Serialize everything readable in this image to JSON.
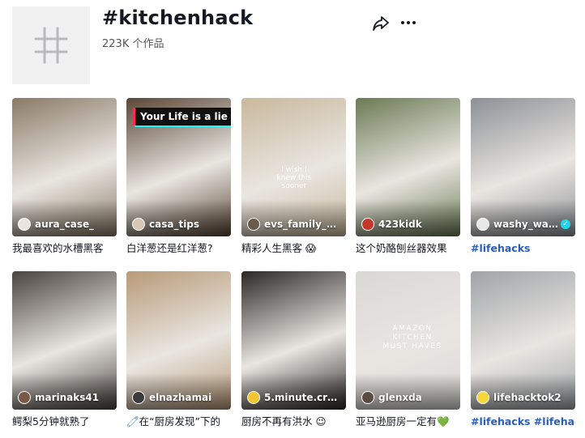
{
  "header": {
    "title": "#kitchenhack",
    "count": "223K 个作品"
  },
  "videos": [
    {
      "user": "aura_case_",
      "caption": "我最喜欢的水槽黑客",
      "tag": false,
      "verified": false,
      "overlay": ""
    },
    {
      "user": "casa_tips",
      "caption": "白洋葱还是红洋葱?",
      "tag": false,
      "verified": false,
      "overlay": "Your Life is a lie"
    },
    {
      "user": "evs_family_h...",
      "caption": "精彩人生黑客 😱",
      "tag": false,
      "verified": false,
      "overlay": "I wish I knew this sooner"
    },
    {
      "user": "423kidk",
      "caption": "这个奶酪刨丝器效果",
      "tag": false,
      "verified": false,
      "overlay": ""
    },
    {
      "user": "washy_wa...",
      "caption": "#lifehacks",
      "tag": true,
      "verified": true,
      "overlay": ""
    },
    {
      "user": "marinaks41",
      "caption": "鳄梨5分钟就熟了",
      "tag": false,
      "verified": false,
      "overlay": ""
    },
    {
      "user": "elnazhamai",
      "caption": "🧷在“厨房发现”下的",
      "tag": false,
      "verified": false,
      "overlay": ""
    },
    {
      "user": "5.minute.cra...",
      "caption": "厨房不再有洪水 😉",
      "tag": false,
      "verified": false,
      "overlay": ""
    },
    {
      "user": "glenxda",
      "caption": "亚马逊厨房一定有💚",
      "tag": false,
      "verified": false,
      "overlay": "AMAZON KITCHEN MUST HAVES"
    },
    {
      "user": "lifehacktok2",
      "caption": "#lifehacks #lifehack",
      "tag": true,
      "verified": false,
      "overlay": ""
    }
  ],
  "colors": {
    "tag": "#2b5db9",
    "verified": "#20d5ec",
    "thumbs": [
      "#8a7a66",
      "#5a4636",
      "#c9b89c",
      "#6b7a54",
      "#8d9096",
      "#4a4440",
      "#b89a78",
      "#2a2826",
      "#d8d8d6",
      "#9fa4a8"
    ],
    "avatars": [
      "#e9e4dc",
      "#d8c7b4",
      "#6a5a4a",
      "#c0392b",
      "#e7e7e7",
      "#7a5a46",
      "#3b3b3b",
      "#f3c52f",
      "#5b4a3f",
      "#f5d73a"
    ]
  }
}
